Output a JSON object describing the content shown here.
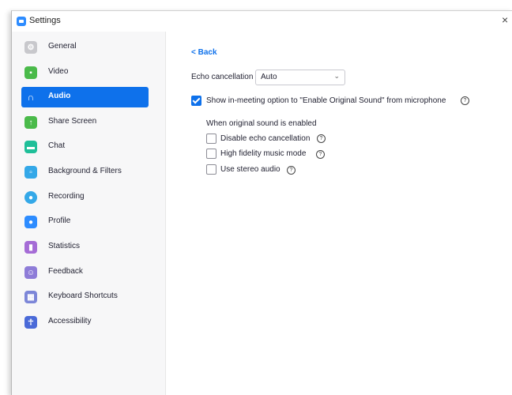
{
  "window": {
    "title": "Settings",
    "close_glyph": "×"
  },
  "sidebar": {
    "items": [
      {
        "label": "General",
        "icon": "gear-icon",
        "color": "#c8c8cc",
        "active": false
      },
      {
        "label": "Video",
        "icon": "video-icon",
        "color": "#4aba4a",
        "active": false
      },
      {
        "label": "Audio",
        "icon": "headphones-icon",
        "color": "#0e71eb",
        "active": true
      },
      {
        "label": "Share Screen",
        "icon": "share-screen-icon",
        "color": "#4aba4a",
        "active": false
      },
      {
        "label": "Chat",
        "icon": "chat-icon",
        "color": "#1fbf99",
        "active": false
      },
      {
        "label": "Background & Filters",
        "icon": "background-icon",
        "color": "#34a8e8",
        "active": false
      },
      {
        "label": "Recording",
        "icon": "recording-icon",
        "color": "#34a8e8",
        "active": false
      },
      {
        "label": "Profile",
        "icon": "profile-icon",
        "color": "#2d8cff",
        "active": false
      },
      {
        "label": "Statistics",
        "icon": "statistics-icon",
        "color": "#a56cd6",
        "active": false
      },
      {
        "label": "Feedback",
        "icon": "feedback-icon",
        "color": "#8e7cd8",
        "active": false
      },
      {
        "label": "Keyboard Shortcuts",
        "icon": "keyboard-icon",
        "color": "#7c86d8",
        "active": false
      },
      {
        "label": "Accessibility",
        "icon": "accessibility-icon",
        "color": "#4a6ad8",
        "active": false
      }
    ]
  },
  "content": {
    "back_label": "< Back",
    "echo": {
      "label": "Echo cancellation",
      "value": "Auto",
      "chevron": "⌄"
    },
    "original_sound": {
      "label": "Show in-meeting option to \"Enable Original Sound\" from microphone",
      "checked": true
    },
    "sub_heading": "When original sound is enabled",
    "options": [
      {
        "label": "Disable echo cancellation",
        "checked": false
      },
      {
        "label": "High fidelity music mode",
        "checked": false
      },
      {
        "label": "Use stereo audio",
        "checked": false
      }
    ],
    "help_glyph": "?"
  }
}
